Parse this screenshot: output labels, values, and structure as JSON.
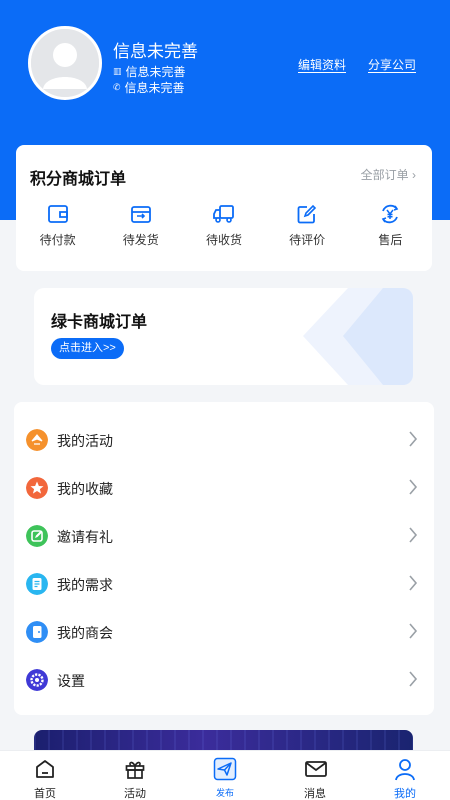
{
  "profile": {
    "name": "信息未完善",
    "company": "信息未完善",
    "phone": "信息未完善",
    "edit_label": "编辑资料",
    "share_label": "分享公司"
  },
  "points_orders": {
    "title": "积分商城订单",
    "all_label": "全部订单",
    "items": [
      {
        "label": "待付款",
        "icon": "wallet-icon"
      },
      {
        "label": "待发货",
        "icon": "package-icon"
      },
      {
        "label": "待收货",
        "icon": "truck-icon"
      },
      {
        "label": "待评价",
        "icon": "edit-review-icon"
      },
      {
        "label": "售后",
        "icon": "yuan-refund-icon"
      }
    ]
  },
  "green_card": {
    "title": "绿卡商城订单",
    "enter_label": "点击进入>>"
  },
  "menu": [
    {
      "label": "我的活动",
      "icon": "activity-icon",
      "color": "#f5912c"
    },
    {
      "label": "我的收藏",
      "icon": "star-icon",
      "color": "#f2673c"
    },
    {
      "label": "邀请有礼",
      "icon": "invite-edit-icon",
      "color": "#3ec35a"
    },
    {
      "label": "我的需求",
      "icon": "document-icon",
      "color": "#29b6f0"
    },
    {
      "label": "我的商会",
      "icon": "door-icon",
      "color": "#2f8ef5"
    },
    {
      "label": "设置",
      "icon": "gear-icon",
      "color": "#3f39d6"
    }
  ],
  "tabbar": [
    {
      "label": "首页",
      "icon": "home-icon"
    },
    {
      "label": "活动",
      "icon": "gift-icon"
    },
    {
      "label": "发布",
      "icon": "send-icon"
    },
    {
      "label": "消息",
      "icon": "mail-icon"
    },
    {
      "label": "我的",
      "icon": "user-icon"
    }
  ],
  "colors": {
    "primary": "#0b6cf7",
    "background": "#f3f5f8"
  }
}
